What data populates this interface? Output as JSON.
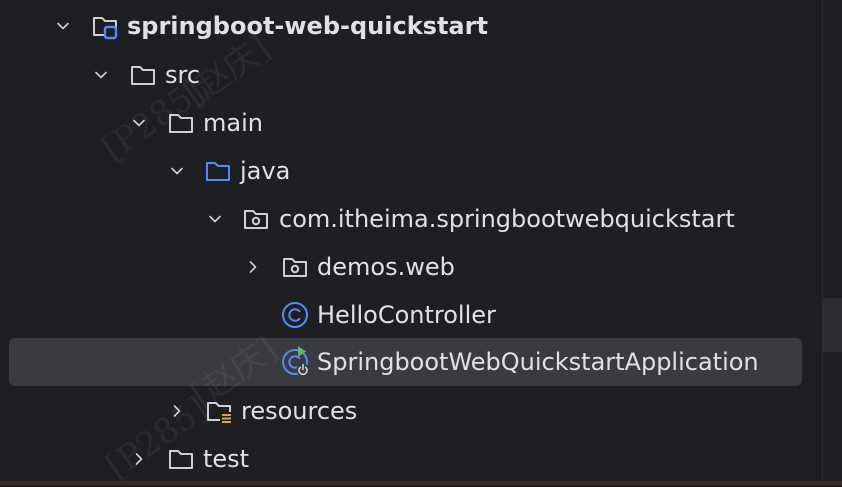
{
  "tree": {
    "items": [
      {
        "label": "springboot-web-quickstart",
        "icon": "module-folder-icon",
        "expanded": true
      },
      {
        "label": "src",
        "icon": "folder-icon",
        "expanded": true
      },
      {
        "label": "main",
        "icon": "folder-icon",
        "expanded": true
      },
      {
        "label": "java",
        "icon": "source-root-folder-icon",
        "expanded": true
      },
      {
        "label": "com.itheima.springbootwebquickstart",
        "icon": "package-icon",
        "expanded": true
      },
      {
        "label": "demos.web",
        "icon": "package-icon",
        "expanded": false
      },
      {
        "label": "HelloController",
        "icon": "java-class-icon"
      },
      {
        "label": "SpringbootWebQuickstartApplication",
        "icon": "spring-boot-application-icon",
        "selected": true
      },
      {
        "label": "resources",
        "icon": "resources-folder-icon",
        "expanded": false
      },
      {
        "label": "test",
        "icon": "folder-icon",
        "expanded": false
      }
    ]
  },
  "colors": {
    "background": "#1e1f22",
    "selection": "#393b40",
    "text": "#dfe1e5",
    "icon_stroke": "#ced0d6",
    "source_root": "#548af7",
    "class_icon": "#548af7",
    "run_green": "#5fb865",
    "resources_yellow": "#d9a343",
    "module_badge": "#548af7"
  },
  "watermark": [
    "[P285]",
    "[赵庆]"
  ]
}
